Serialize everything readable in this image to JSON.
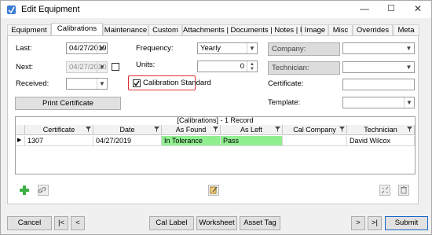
{
  "window": {
    "title": "Edit Equipment",
    "controls": [
      "—",
      "☐",
      "✕"
    ]
  },
  "tabs": [
    "Equipment",
    "Calibrations",
    "Maintenance",
    "Custom",
    "Attachments | Documents | Notes | Parts",
    "Image",
    "Misc",
    "Overrides",
    "Meta"
  ],
  "form": {
    "last_label": "Last:",
    "last_value": "04/27/2019",
    "next_label": "Next:",
    "next_value": "04/27/2020",
    "received_label": "Received:",
    "received_value": "",
    "frequency_label": "Frequency:",
    "frequency_value": "Yearly",
    "units_label": "Units:",
    "units_value": "0",
    "cal_standard_label": "Calibration Standard",
    "cal_standard_checked": true,
    "company_label": "Company:",
    "company_value": "",
    "technician_label": "Technician:",
    "technician_value": "",
    "certificate_label": "Certificate:",
    "certificate_value": "",
    "template_label": "Template:",
    "template_value": "",
    "print_certificate_label": "Print Certificate"
  },
  "grid": {
    "caption": "[Calibrations] - 1 Record",
    "columns": [
      "Certificate",
      "Date",
      "As Found",
      "As Left",
      "Cal Company",
      "Technician"
    ],
    "rows": [
      {
        "Certificate": "1307",
        "Date": "04/27/2019",
        "As Found": "In Tolerance",
        "As Left": "Pass",
        "Cal Company": "",
        "Technician": "David Wilcox"
      }
    ]
  },
  "footer": {
    "cancel": "Cancel",
    "first": "|<",
    "prev": "<",
    "cal_label": "Cal Label",
    "worksheet": "Worksheet",
    "asset_tag": "Asset Tag",
    "next": ">",
    "last": ">|",
    "submit": "Submit"
  },
  "colors": {
    "highlight_green": "#90ee90",
    "red_outline": "#e03030",
    "accent_blue": "#1a66c8"
  }
}
